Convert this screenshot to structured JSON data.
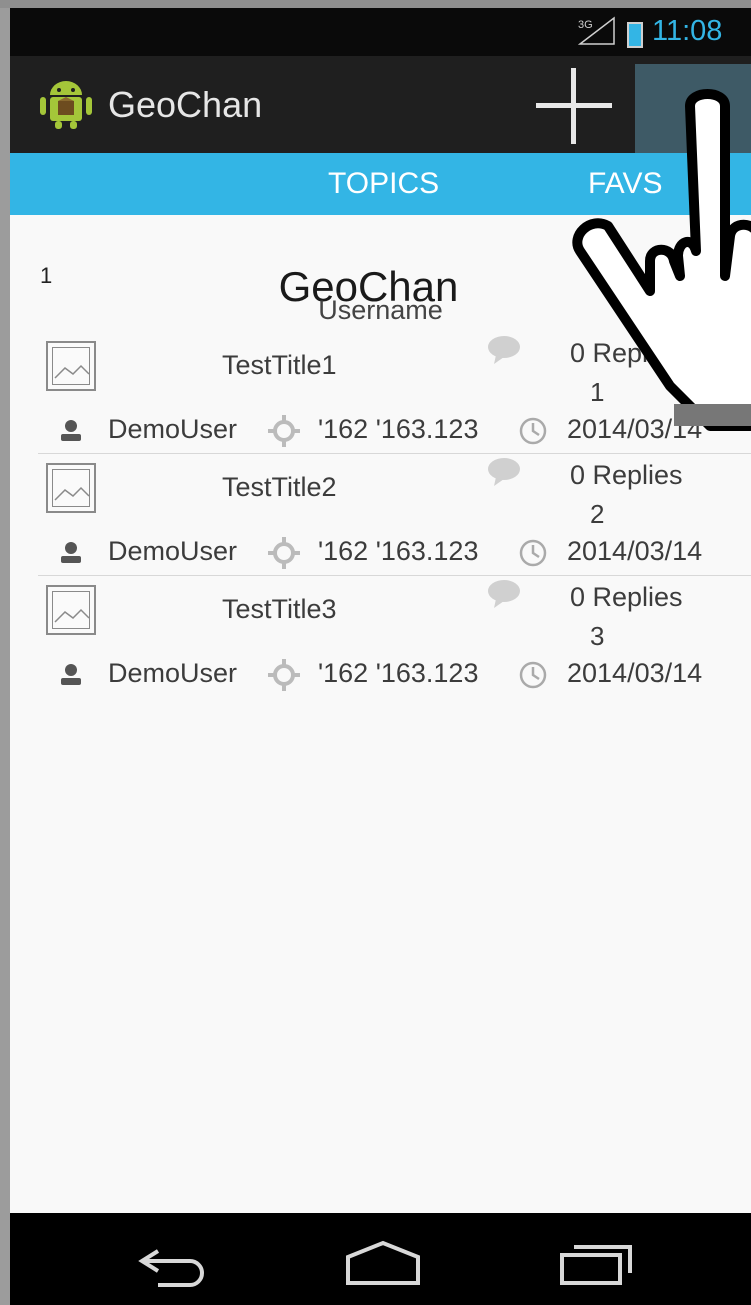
{
  "status_bar": {
    "network": "3G",
    "time": "11:08"
  },
  "action_bar": {
    "title": "GeoChan"
  },
  "tabs": [
    {
      "label": "TOPICS"
    },
    {
      "label": "FAVS"
    }
  ],
  "list_header": {
    "count": "1",
    "title": "GeoChan",
    "username": "Username"
  },
  "topics": [
    {
      "title": "TestTitle1",
      "replies": "0 Replies",
      "index": "1",
      "user": "DemoUser",
      "coords": "'162 '163.123",
      "date": "2014/03/14"
    },
    {
      "title": "TestTitle2",
      "replies": "0 Replies",
      "index": "2",
      "user": "DemoUser",
      "coords": "'162 '163.123",
      "date": "2014/03/14"
    },
    {
      "title": "TestTitle3",
      "replies": "0 Replies",
      "index": "3",
      "user": "DemoUser",
      "coords": "'162 '163.123",
      "date": "2014/03/14"
    }
  ],
  "icons": {
    "app": "android-icon",
    "add": "plus-icon",
    "thumb": "image-icon",
    "reply": "speech-bubble-icon",
    "user": "person-icon",
    "location": "location-icon",
    "time": "clock-icon",
    "back": "back-arrow-icon",
    "home": "home-icon",
    "recent": "recent-apps-icon",
    "pointer": "hand-pointer-icon"
  },
  "colors": {
    "accent": "#33b5e5",
    "action_bar": "#1f1f1f",
    "status_bar": "#0a0a0a",
    "nav_bar": "#000000"
  }
}
